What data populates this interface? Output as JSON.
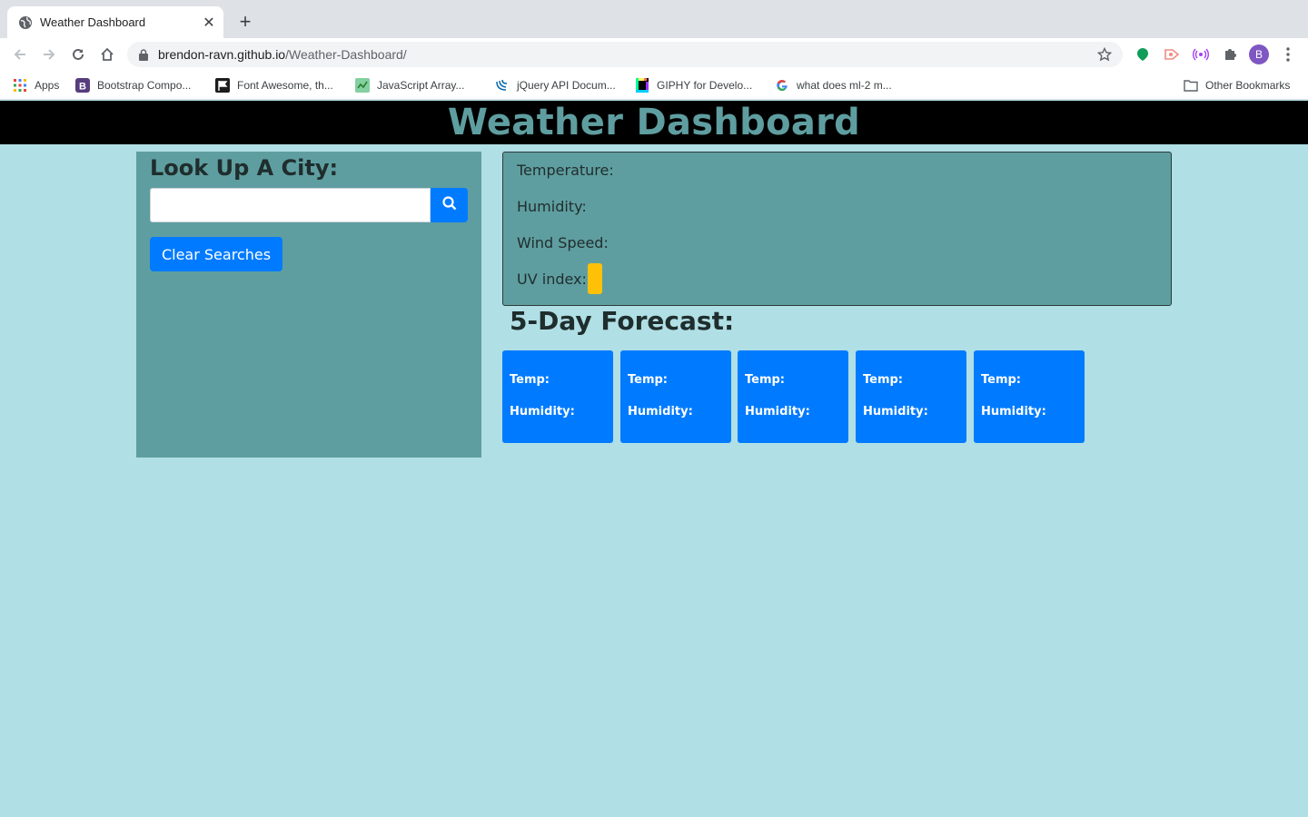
{
  "browser": {
    "tab_title": "Weather Dashboard",
    "url_host": "brendon-ravn.github.io",
    "url_path": "/Weather-Dashboard/",
    "profile_initial": "B",
    "bookmarks": [
      {
        "label": "Apps",
        "icon": "apps-grid-icon"
      },
      {
        "label": "Bootstrap Compo...",
        "icon": "bootstrap-icon"
      },
      {
        "label": "Font Awesome, th...",
        "icon": "font-awesome-flag-icon"
      },
      {
        "label": "JavaScript Array...",
        "icon": "javascript-icon"
      },
      {
        "label": "jQuery API Docum...",
        "icon": "jquery-icon"
      },
      {
        "label": "GIPHY for Develo...",
        "icon": "giphy-icon"
      },
      {
        "label": "what does ml-2 m...",
        "icon": "google-icon"
      }
    ],
    "other_bookmarks": "Other Bookmarks"
  },
  "page": {
    "title": "Weather Dashboard",
    "sidebar": {
      "heading": "Look Up A City:",
      "search_value": "",
      "clear_label": "Clear Searches"
    },
    "current": {
      "temperature_label": "Temperature:",
      "humidity_label": "Humidity:",
      "wind_label": "Wind Speed:",
      "uv_label": "UV index:"
    },
    "forecast_title": "5-Day Forecast:",
    "forecast": [
      {
        "temp_label": "Temp:",
        "humidity_label": "Humidity:"
      },
      {
        "temp_label": "Temp:",
        "humidity_label": "Humidity:"
      },
      {
        "temp_label": "Temp:",
        "humidity_label": "Humidity:"
      },
      {
        "temp_label": "Temp:",
        "humidity_label": "Humidity:"
      },
      {
        "temp_label": "Temp:",
        "humidity_label": "Humidity:"
      }
    ]
  },
  "colors": {
    "page_bg": "#b0dfe5",
    "panel": "#5f9ea0",
    "header_bg": "#000000",
    "primary": "#007bff",
    "uv_badge": "#ffc107"
  }
}
